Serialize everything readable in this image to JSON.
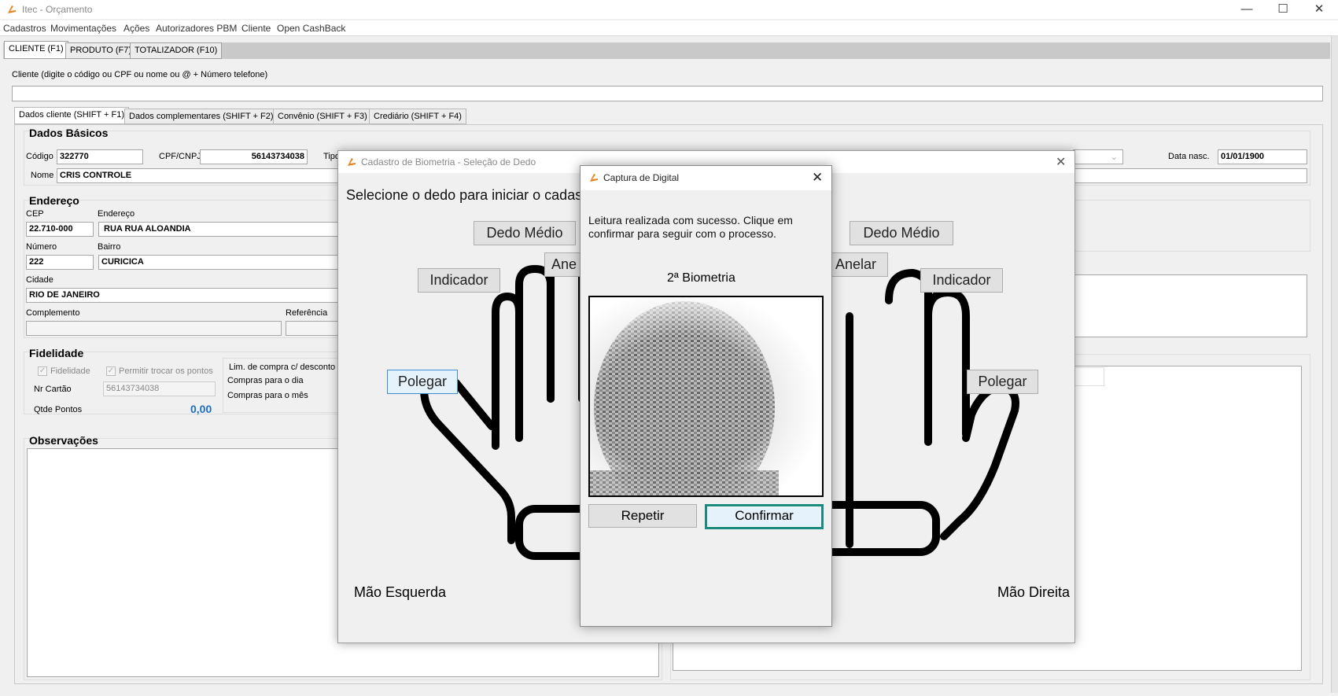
{
  "window": {
    "title": "Itec - Orçamento"
  },
  "menu": [
    "Cadastros",
    "Movimentações",
    "Ações",
    "Autorizadores PBM",
    "Cliente",
    "Open CashBack"
  ],
  "main_tabs": [
    "CLIENTE (F1)",
    "PRODUTO (F7)",
    "TOTALIZADOR (F10)"
  ],
  "search": {
    "label": "Cliente (digite o código ou CPF ou nome ou @ + Número telefone)",
    "value": ""
  },
  "sub_tabs": [
    "Dados cliente (SHIFT + F1)",
    "Dados complementares (SHIFT + F2)",
    "Convênio (SHIFT + F3)",
    "Crediário (SHIFT + F4)"
  ],
  "dados_basicos": {
    "title": "Dados Básicos",
    "codigo_label": "Código",
    "codigo": "322770",
    "cpf_label": "CPF/CNPJ",
    "cpf": "56143734038",
    "tipo_label": "Tipo",
    "nome_label": "Nome",
    "nome": "CRIS CONTROLE",
    "data_nasc_label": "Data nasc.",
    "data_nasc": "01/01/1900"
  },
  "endereco": {
    "title": "Endereço",
    "cep_label": "CEP",
    "cep": "22.710-000",
    "endereco_label": "Endereço",
    "endereco": "RUA RUA ALOANDIA",
    "numero_label": "Número",
    "numero": "222",
    "bairro_label": "Bairro",
    "bairro": "CURICICA",
    "cidade_label": "Cidade",
    "cidade": "RIO DE JANEIRO",
    "complemento_label": "Complemento",
    "complemento": "",
    "referencia_label": "Referência",
    "referencia": ""
  },
  "fidelidade": {
    "title": "Fidelidade",
    "chk_fidelidade": "Fidelidade",
    "chk_trocar": "Permitir trocar os pontos",
    "nr_cartao_label": "Nr Cartão",
    "nr_cartao": "56143734038",
    "qtde_label": "Qtde Pontos",
    "qtde": "0,00",
    "lim_label": "Lim. de compra c/ desconto",
    "dia_label": "Compras para o dia",
    "mes_label": "Compras para o mês"
  },
  "observacoes": {
    "title": "Observações"
  },
  "biometria_dialog": {
    "title": "Cadastro de Biometria - Seleção de Dedo",
    "instruction": "Selecione o dedo para iniciar o cadast",
    "left": {
      "medio": "Dedo Médio",
      "anelar": "Ane",
      "indicador": "Indicador",
      "polegar": "Polegar",
      "label": "Mão Esquerda"
    },
    "right": {
      "medio": "Dedo Médio",
      "anelar": "Anelar",
      "indicador": "Indicador",
      "polegar": "Polegar",
      "label": "Mão Direita"
    }
  },
  "captura_dialog": {
    "title": "Captura de Digital",
    "message": "Leitura realizada com sucesso. Clique em confirmar para seguir com o processo.",
    "biometria_label": "2ª Biometria",
    "repetir": "Repetir",
    "confirmar": "Confirmar"
  },
  "colors": {
    "accent": "#1a8a80",
    "points": "#1f6fc0"
  }
}
